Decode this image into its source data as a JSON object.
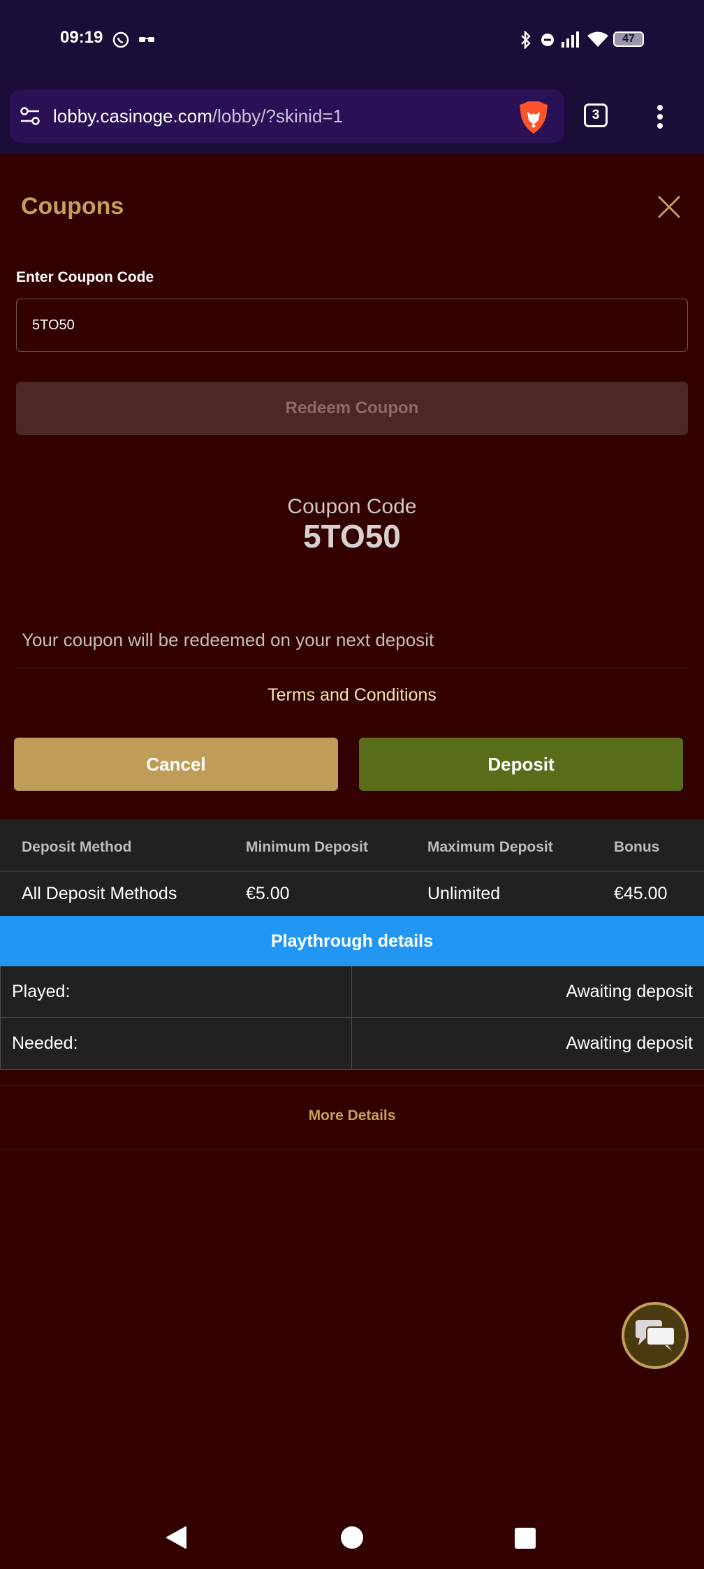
{
  "status_bar": {
    "time": "09:19",
    "battery": "47",
    "icons": [
      "whatsapp-icon",
      "glasses-icon",
      "bluetooth-icon",
      "dnd-icon",
      "signal-icon",
      "wifi-icon",
      "battery-icon"
    ]
  },
  "browser": {
    "url_host": "lobby.casinoge.com",
    "url_path": "/lobby/?skinid=1",
    "tab_count": "3",
    "brand_color": "#fb542b"
  },
  "modal": {
    "title": "Coupons",
    "input_label": "Enter Coupon Code",
    "input_value": "5TO50",
    "redeem_label": "Redeem Coupon",
    "coupon_code_label": "Coupon Code",
    "coupon_code": "5TO50",
    "note": "Your coupon will be redeemed on your next deposit",
    "terms_link": "Terms and Conditions",
    "cancel_label": "Cancel",
    "deposit_label": "Deposit"
  },
  "deposit_table": {
    "headers": [
      "Deposit Method",
      "Minimum Deposit",
      "Maximum Deposit",
      "Bonus"
    ],
    "row": [
      "All Deposit Methods",
      "€5.00",
      "Unlimited",
      "€45.00"
    ]
  },
  "playthrough": {
    "title": "Playthrough details",
    "rows": [
      {
        "key": "Played:",
        "value": "Awaiting deposit"
      },
      {
        "key": "Needed:",
        "value": "Awaiting deposit"
      }
    ]
  },
  "more_details": "More Details",
  "colors": {
    "background": "#330000",
    "accent_gold": "#c2a05a",
    "deposit_green": "#596d1a",
    "playthrough_blue": "#2196f3"
  }
}
